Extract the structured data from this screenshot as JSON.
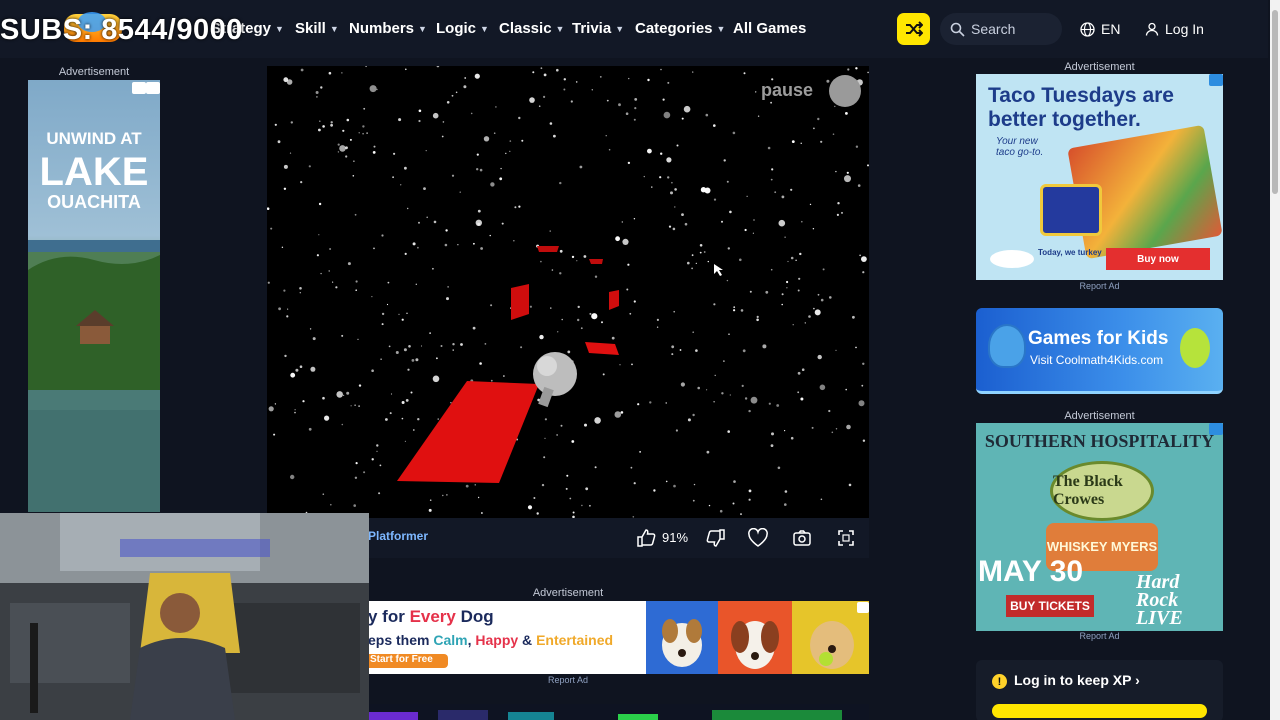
{
  "overlay": {
    "subs_text": "SUBS: 8544/9000"
  },
  "nav": {
    "items": [
      {
        "label": "Strategy",
        "has_menu": true
      },
      {
        "label": "Skill",
        "has_menu": true
      },
      {
        "label": "Numbers",
        "has_menu": true
      },
      {
        "label": "Logic",
        "has_menu": true
      },
      {
        "label": "Classic",
        "has_menu": true
      },
      {
        "label": "Trivia",
        "has_menu": true
      },
      {
        "label": "Categories",
        "has_menu": true
      },
      {
        "label": "All Games",
        "has_menu": false
      }
    ],
    "search_placeholder": "Search",
    "language": "EN",
    "login_label": "Log In"
  },
  "ads": {
    "label": "Advertisement",
    "report_label": "Report Ad",
    "left": {
      "line1": "UNWIND AT",
      "line2": "LAKE",
      "line3": "OUACHITA"
    },
    "taco": {
      "headline": "Taco Tuesdays are better together.",
      "sub": "Your new taco go-to.",
      "tagline": "Today, we turkey",
      "cta": "Buy now"
    },
    "kids": {
      "headline": "Games for Kids",
      "sub": "Visit Coolmath4Kids.com"
    },
    "concert": {
      "headline": "SOUTHERN HOSPITALITY",
      "band1": "The Black Crowes",
      "band2": "WHISKEY MYERS",
      "date": "MAY 30",
      "cta": "BUY TICKETS",
      "venue": "Hard Rock LIVE"
    },
    "dog": {
      "line1_prefix": "y for ",
      "line1_highlight": "Every",
      "line1_suffix": " Dog",
      "line2_a": "eps them ",
      "line2_b": "Calm",
      "line2_c": ", ",
      "line2_d": "Happy",
      "line2_e": " & ",
      "line2_f": "Entertained",
      "cta": "Start for Free"
    }
  },
  "game": {
    "pause_label": "pause",
    "genre": "Platformer",
    "rating": "91%"
  },
  "sidebar": {
    "login_xp": "Log in to keep XP"
  },
  "colors": {
    "accent": "#ffe600",
    "game_platform": "#e01010",
    "bg": "#0f1420"
  }
}
